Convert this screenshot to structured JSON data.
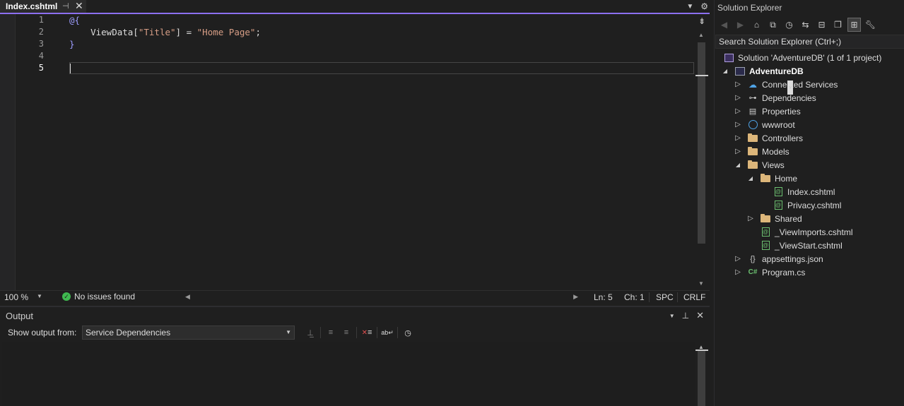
{
  "editor": {
    "tab_title": "Index.cshtml",
    "pin_glyph": "⊣",
    "close_glyph": "✕",
    "lines": [
      {
        "number": "1",
        "tokens": [
          {
            "t": "@{",
            "k": "razor"
          }
        ]
      },
      {
        "number": "2",
        "tokens": [
          {
            "t": "    ViewData[",
            "k": "plain"
          },
          {
            "t": "\"Title\"",
            "k": "str"
          },
          {
            "t": "] = ",
            "k": "plain"
          },
          {
            "t": "\"Home Page\"",
            "k": "str"
          },
          {
            "t": ";",
            "k": "plain"
          }
        ]
      },
      {
        "number": "3",
        "tokens": [
          {
            "t": "}",
            "k": "razor"
          }
        ]
      },
      {
        "number": "4",
        "tokens": []
      },
      {
        "number": "5",
        "tokens": []
      }
    ],
    "current_line": "5"
  },
  "status": {
    "zoom": "100 %",
    "issues": "No issues found",
    "line": "Ln: 5",
    "col": "Ch: 1",
    "whitespace": "SPC",
    "line_ending": "CRLF"
  },
  "output": {
    "title": "Output",
    "show_from_label": "Show output from:",
    "source": "Service Dependencies"
  },
  "solution_explorer": {
    "title": "Solution Explorer",
    "search_placeholder": "Search Solution Explorer (Ctrl+;)",
    "tree": [
      {
        "label": "Solution 'AdventureDB' (1 of 1 project)",
        "icon": "solution-icon",
        "expander": "",
        "indent": 0
      },
      {
        "label": "AdventureDB",
        "icon": "project-icon",
        "expander": "expanded",
        "indent": 0,
        "bold": true
      },
      {
        "label": "Connected Services",
        "icon": "connected-services-icon",
        "expander": "collapsed",
        "indent": 1
      },
      {
        "label": "Dependencies",
        "icon": "dependencies-icon",
        "expander": "collapsed",
        "indent": 1
      },
      {
        "label": "Properties",
        "icon": "properties-icon",
        "expander": "collapsed",
        "indent": 1
      },
      {
        "label": "wwwroot",
        "icon": "globe-icon",
        "expander": "collapsed",
        "indent": 1
      },
      {
        "label": "Controllers",
        "icon": "folder-icon",
        "expander": "collapsed",
        "indent": 1
      },
      {
        "label": "Models",
        "icon": "folder-icon",
        "expander": "collapsed",
        "indent": 1
      },
      {
        "label": "Views",
        "icon": "folder-icon",
        "expander": "expanded",
        "indent": 1
      },
      {
        "label": "Home",
        "icon": "folder-icon",
        "expander": "expanded",
        "indent": 2
      },
      {
        "label": "Index.cshtml",
        "icon": "razor-file-icon",
        "expander": "",
        "indent": 3
      },
      {
        "label": "Privacy.cshtml",
        "icon": "razor-file-icon",
        "expander": "",
        "indent": 3
      },
      {
        "label": "Shared",
        "icon": "folder-icon",
        "expander": "collapsed",
        "indent": 2
      },
      {
        "label": "_ViewImports.cshtml",
        "icon": "razor-file-icon",
        "expander": "",
        "indent": 2
      },
      {
        "label": "_ViewStart.cshtml",
        "icon": "razor-file-icon",
        "expander": "",
        "indent": 2
      },
      {
        "label": "appsettings.json",
        "icon": "json-file-icon",
        "expander": "collapsed",
        "indent": 1
      },
      {
        "label": "Program.cs",
        "icon": "csharp-file-icon",
        "expander": "collapsed",
        "indent": 1
      }
    ]
  },
  "colors": {
    "accent": "#8c6ff0",
    "background": "#1f1f1f",
    "string": "#d69d85",
    "razor": "#9c9cfe",
    "ok": "#3fb950"
  }
}
